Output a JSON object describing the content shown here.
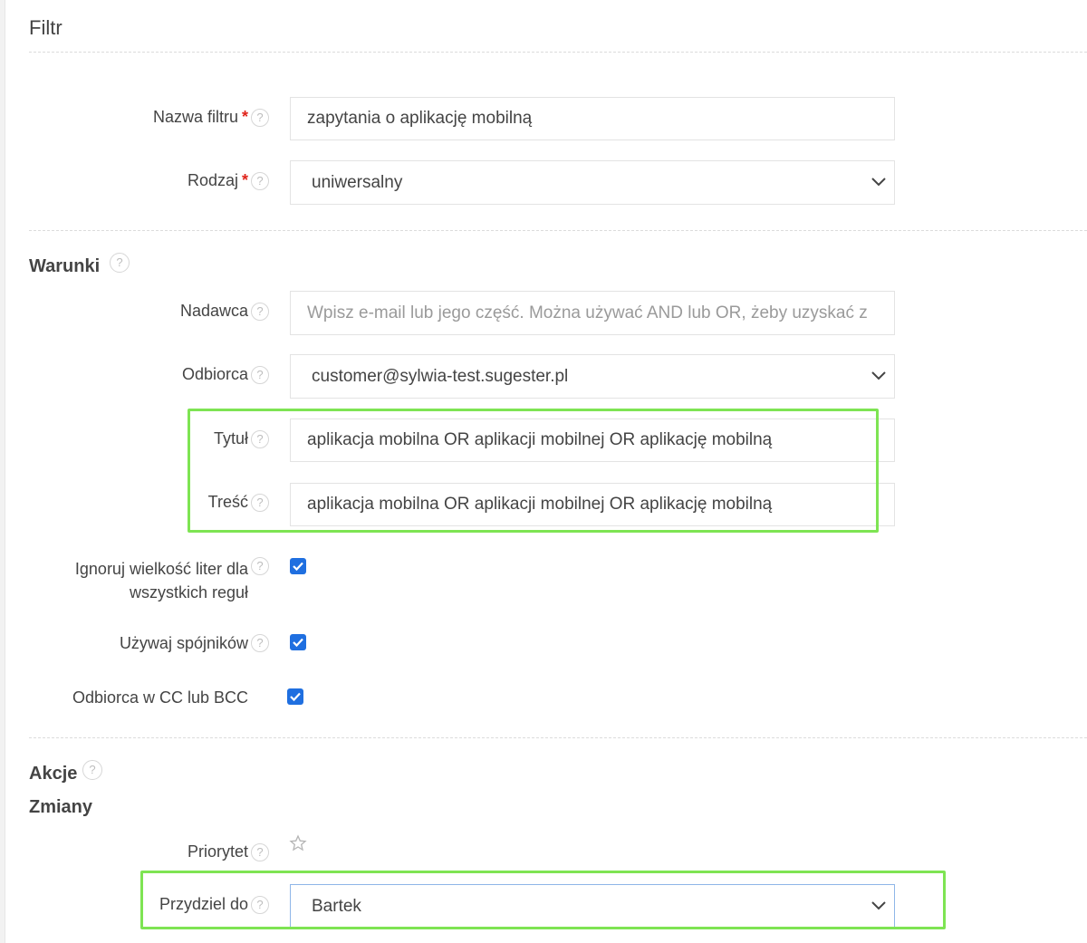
{
  "page": {
    "title": "Filtr"
  },
  "basic": {
    "name": {
      "label": "Nazwa filtru",
      "required_mark": "*",
      "value": "zapytania o aplikację mobilną"
    },
    "type": {
      "label": "Rodzaj",
      "required_mark": "*",
      "value": "uniwersalny"
    }
  },
  "conditions": {
    "title": "Warunki",
    "sender": {
      "label": "Nadawca",
      "placeholder": "Wpisz e-mail lub jego część. Można używać AND lub OR, żeby uzyskać z"
    },
    "recipient": {
      "label": "Odbiorca",
      "value": "customer@sylwia-test.sugester.pl"
    },
    "subject": {
      "label": "Tytuł",
      "value": "aplikacja mobilna OR aplikacji mobilnej OR aplikację mobilną"
    },
    "body": {
      "label": "Treść",
      "value": "aplikacja mobilna OR aplikacji mobilnej OR aplikację mobilną"
    },
    "ignore_case": {
      "label_line1": "Ignoruj wielkość liter dla",
      "label_line2": "wszystkich reguł",
      "checked": true
    },
    "use_conjunctions": {
      "label": "Używaj spójników",
      "checked": true
    },
    "recipient_cc_bcc": {
      "label": "Odbiorca w CC lub BCC",
      "checked": true
    }
  },
  "actions": {
    "title": "Akcje",
    "changes_title": "Zmiany",
    "priority": {
      "label": "Priorytet",
      "icon": "star-outline-icon",
      "rating": 0
    },
    "assign": {
      "label": "Przydziel do",
      "value": "Bartek"
    }
  },
  "help_glyph": "?",
  "colors": {
    "highlight": "#7ee453",
    "checkbox": "#1f6fe0",
    "required": "#e0241b"
  }
}
